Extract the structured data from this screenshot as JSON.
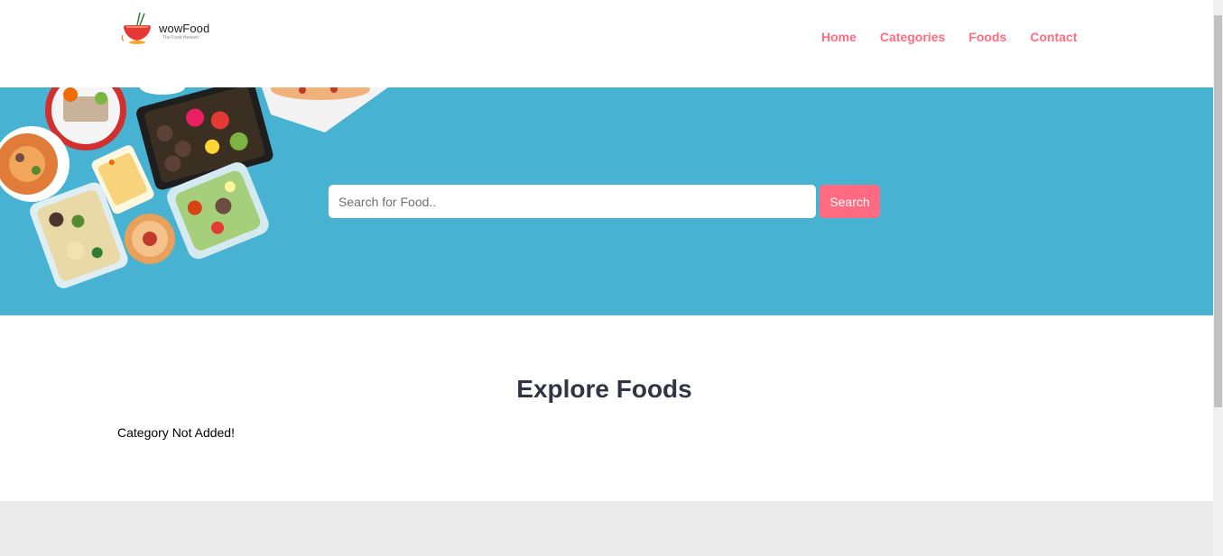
{
  "header": {
    "logo_name": "wowFood",
    "logo_tagline": "The Food Heaven",
    "nav": [
      {
        "label": "Home"
      },
      {
        "label": "Categories"
      },
      {
        "label": "Foods"
      },
      {
        "label": "Contact"
      }
    ]
  },
  "search": {
    "placeholder": "Search for Food..",
    "value": "",
    "button_label": "Search"
  },
  "explore": {
    "title": "Explore Foods",
    "message": "Category Not Added!"
  },
  "colors": {
    "accent": "#ff6b81",
    "hero_bg": "#47b2d1",
    "title": "#2f3542",
    "footer_bg": "#ebebeb"
  }
}
